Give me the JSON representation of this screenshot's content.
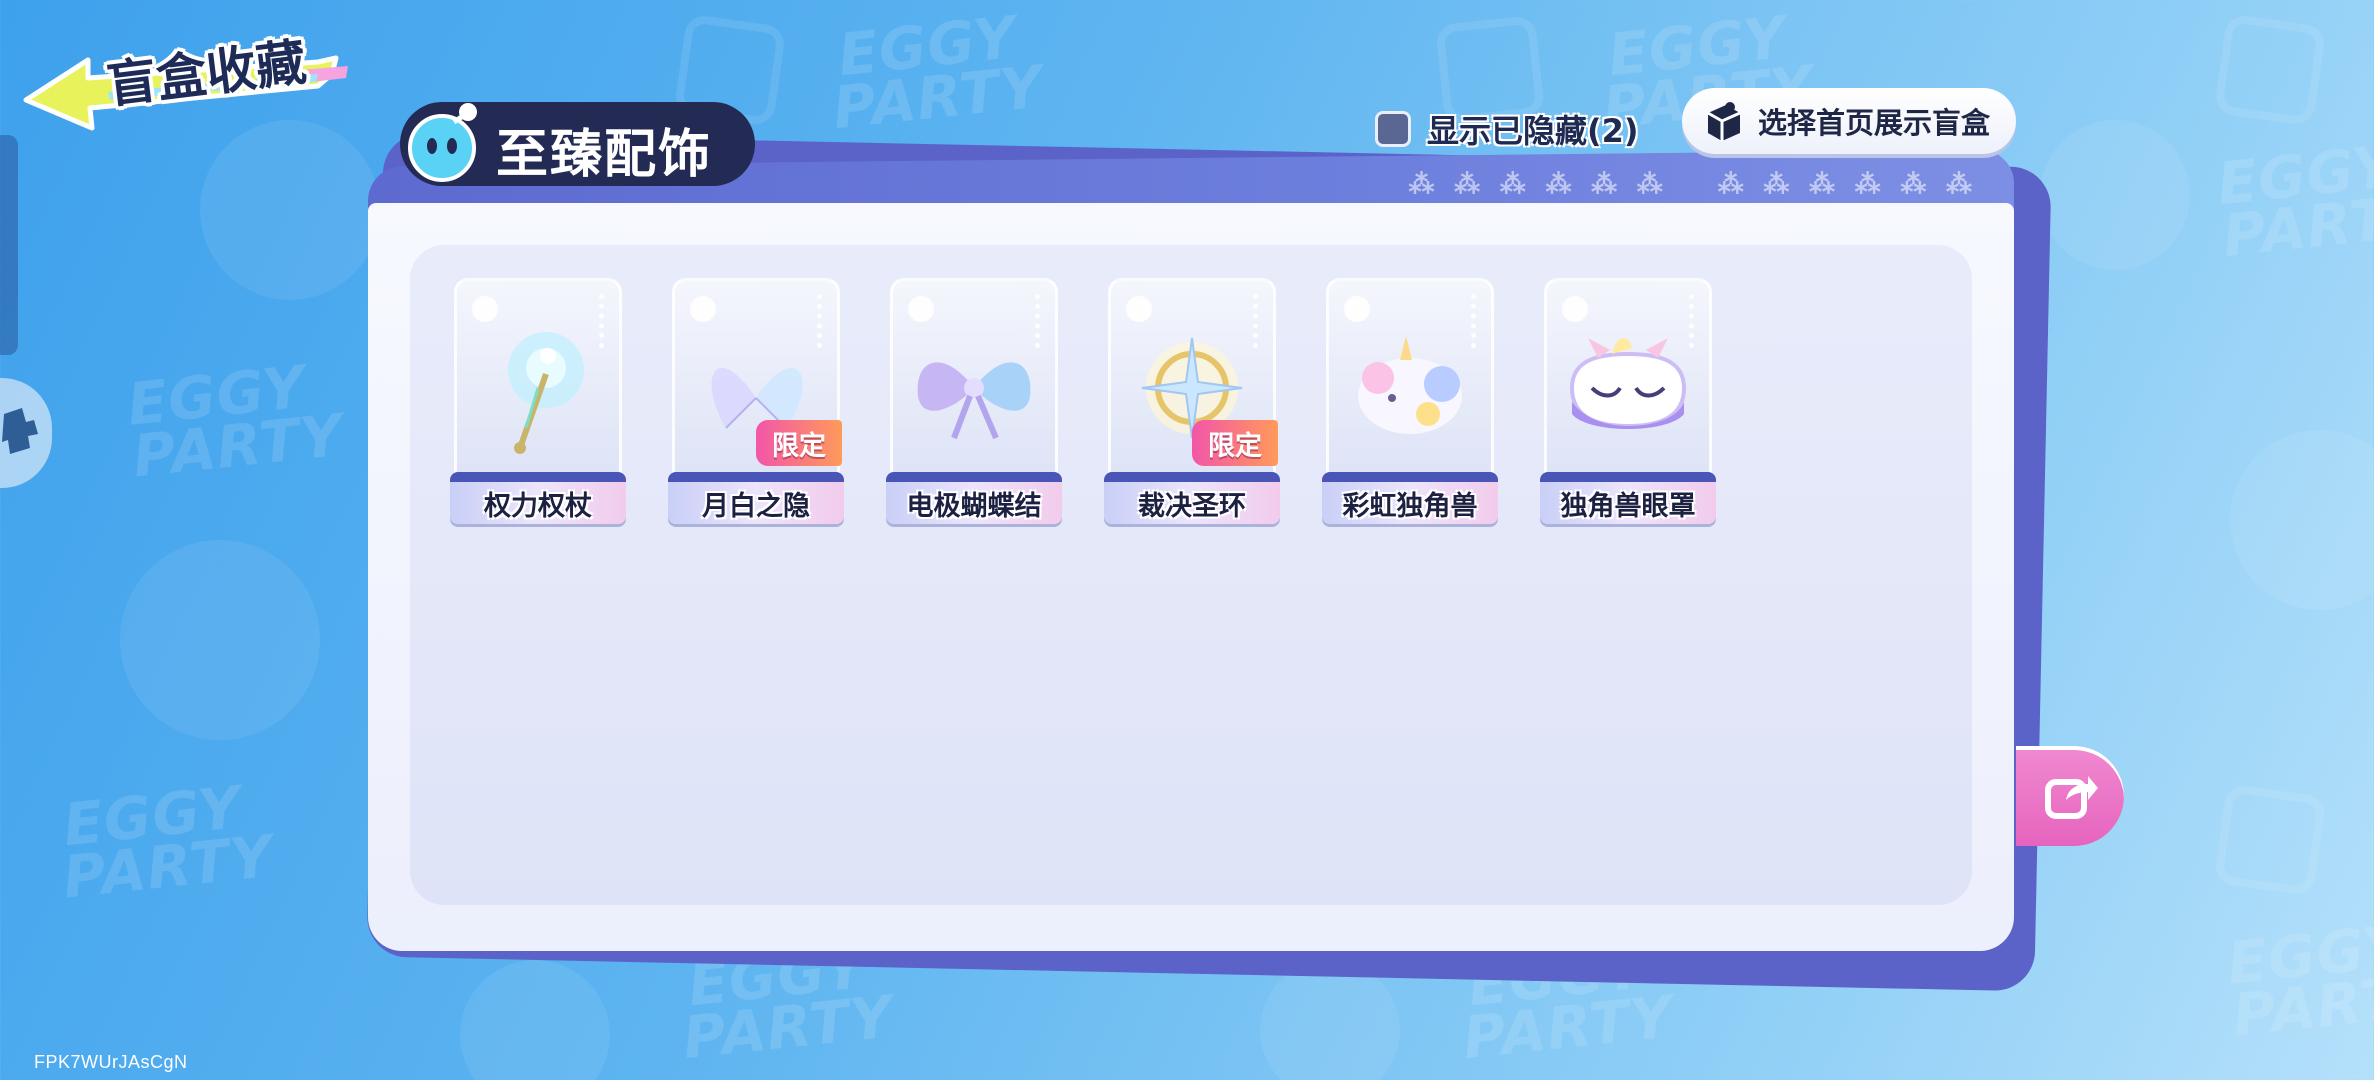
{
  "header": {
    "back_title": "盲盒收藏"
  },
  "category": {
    "title": "至臻配饰"
  },
  "toolbar": {
    "show_hidden_label": "显示已隐藏(2)",
    "select_display_label": "选择首页展示盲盒"
  },
  "items": [
    {
      "name": "权力权杖",
      "badge": ""
    },
    {
      "name": "月白之隐",
      "badge": "限定"
    },
    {
      "name": "电极蝴蝶结",
      "badge": ""
    },
    {
      "name": "裁决圣环",
      "badge": "限定"
    },
    {
      "name": "彩虹独角兽",
      "badge": ""
    },
    {
      "name": "独角兽眼罩",
      "badge": ""
    }
  ],
  "background": {
    "watermark_text": "EGGY PARTY"
  },
  "footer": {
    "user_id": "FPK7WUrJAsCgN"
  },
  "colors": {
    "background": "#5db4f0",
    "panel_header": "#5d6ad0",
    "limited_badge": "#f256a8",
    "share_button": "#e664be",
    "title_dark": "#232b55"
  }
}
